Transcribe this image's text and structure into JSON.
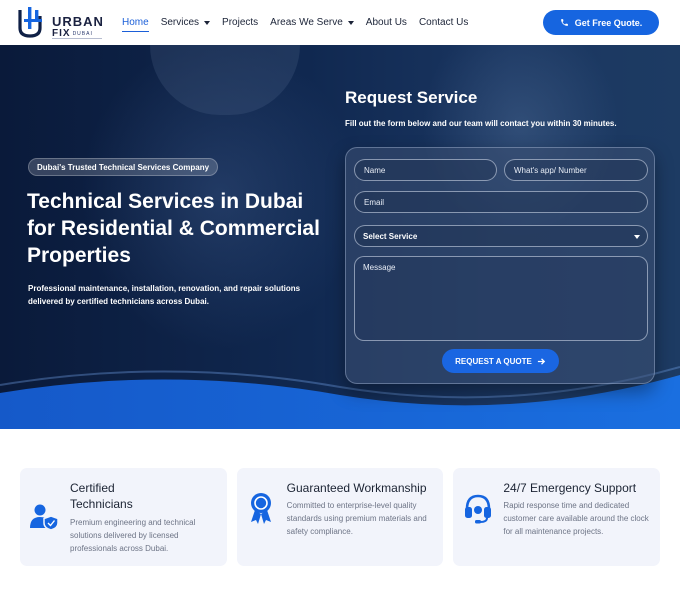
{
  "brand": {
    "line1": "URBAN",
    "line2": "FIX",
    "line2_sub": "DUBAI",
    "accent_color": "#1665e0",
    "dark_color": "#0f2046"
  },
  "nav": {
    "items": [
      {
        "label": "Home",
        "active": true,
        "dropdown": false
      },
      {
        "label": "Services",
        "active": false,
        "dropdown": true
      },
      {
        "label": "Projects",
        "active": false,
        "dropdown": false
      },
      {
        "label": "Areas We Serve",
        "active": false,
        "dropdown": true
      },
      {
        "label": "About Us",
        "active": false,
        "dropdown": false
      },
      {
        "label": "Contact Us",
        "active": false,
        "dropdown": false
      }
    ],
    "cta_label": "Get Free Quote.",
    "cta_icon": "phone-icon"
  },
  "hero": {
    "badge": "Dubai's Trusted Technical Services Company",
    "title": "Technical Services in Dubai for Residential & Commercial Properties",
    "description": "Professional maintenance, installation, renovation, and repair solutions delivered by certified technicians across Dubai."
  },
  "form": {
    "title": "Request Service",
    "subtitle": "Fill out the form below and our team will contact you within 30 minutes.",
    "name_placeholder": "Name",
    "phone_placeholder": "What's app/ Number",
    "email_placeholder": "Email",
    "service_selected": "Select Service",
    "message_placeholder": "Message",
    "submit_label": "REQUEST A QUOTE",
    "submit_icon": "arrow-right-icon"
  },
  "features": [
    {
      "title": "Certified Technicians",
      "title_line1": "Certified",
      "title_line2": "Technicians",
      "description": "Premium engineering and technical solutions delivered by licensed professionals across Dubai.",
      "icon": "certified-user-shield-icon"
    },
    {
      "title": "Guaranteed Workmanship",
      "description": "Committed to enterprise-level quality standards using premium materials and safety compliance.",
      "icon": "award-ribbon-icon"
    },
    {
      "title": "24/7 Emergency Support",
      "description": "Rapid response time and dedicated customer care available around the clock for all maintenance projects.",
      "icon": "headset-support-icon"
    }
  ]
}
